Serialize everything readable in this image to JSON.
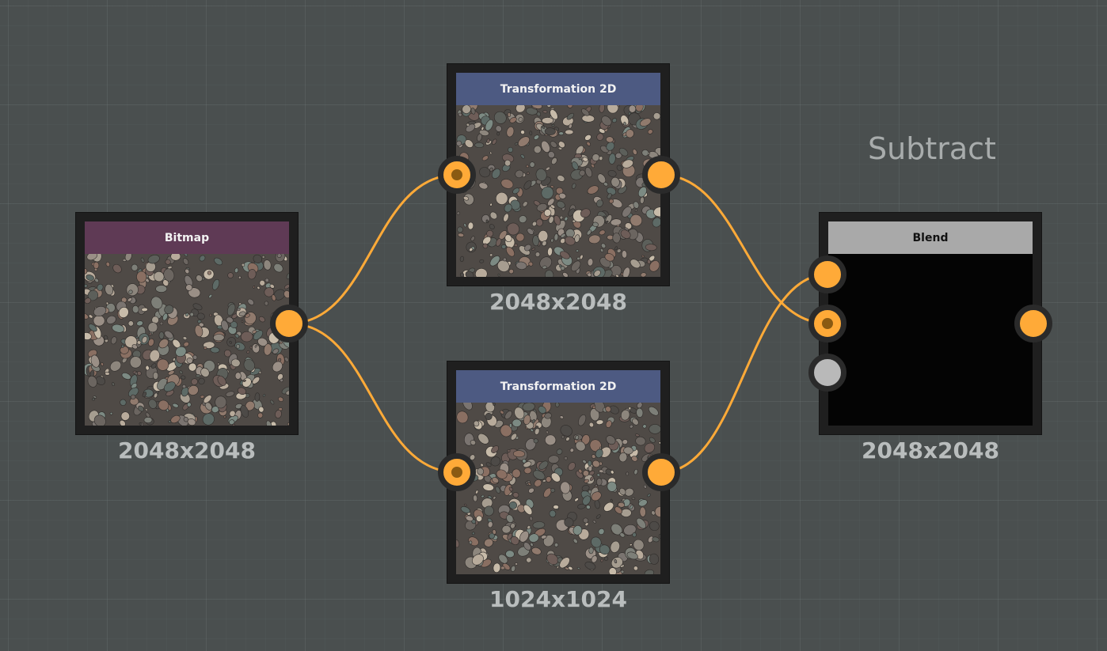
{
  "graph": {
    "comment": "Subtract",
    "wire_color": "#ffaa38",
    "nodes": {
      "bitmap": {
        "title": "Bitmap",
        "header_color": "#5f3a55",
        "title_color": "#f2f2f2",
        "resolution": "2048x2048",
        "thumbnail": "pebble-texture"
      },
      "transform_top": {
        "title": "Transformation 2D",
        "header_color": "#4d5a82",
        "title_color": "#f2f2f2",
        "resolution": "2048x2048",
        "thumbnail": "pebble-texture"
      },
      "transform_bottom": {
        "title": "Transformation 2D",
        "header_color": "#4d5a82",
        "title_color": "#f2f2f2",
        "resolution": "1024x1024",
        "thumbnail": "pebble-texture"
      },
      "blend": {
        "title": "Blend",
        "header_color": "#a9a9a9",
        "title_color": "#111111",
        "resolution": "2048x2048",
        "thumbnail": "black"
      }
    },
    "port_colors": {
      "active": "#ffaa38",
      "inactive": "#b9b9b9"
    }
  }
}
